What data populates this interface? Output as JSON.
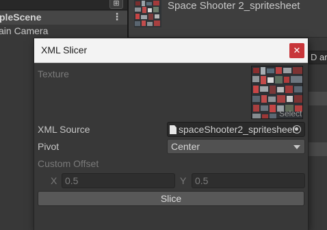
{
  "hierarchy": {
    "search_button_glyph": "⊞",
    "scene_label": "pleScene",
    "kebab_glyph": "⋮",
    "camera_label": "ain Camera"
  },
  "inspector": {
    "asset_title": "Space Shooter 2_spritesheet",
    "partial_field": "D ar"
  },
  "dialog": {
    "title": "XML Slicer",
    "close_glyph": "✕",
    "texture_label": "Texture",
    "texture_select_hint": "Select",
    "xml_source_label": "XML Source",
    "xml_source_value": "spaceShooter2_spritesheet",
    "pivot_label": "Pivot",
    "pivot_value": "Center",
    "custom_offset_label": "Custom Offset",
    "offset_x_label": "X",
    "offset_x_value": "0.5",
    "offset_y_label": "Y",
    "offset_y_value": "0.5",
    "slice_button": "Slice"
  },
  "colors": {
    "titlebar": "#f3f3f3",
    "close_button": "#c8363a",
    "panel": "#383838",
    "disabled_text": "#7a7a7a"
  }
}
